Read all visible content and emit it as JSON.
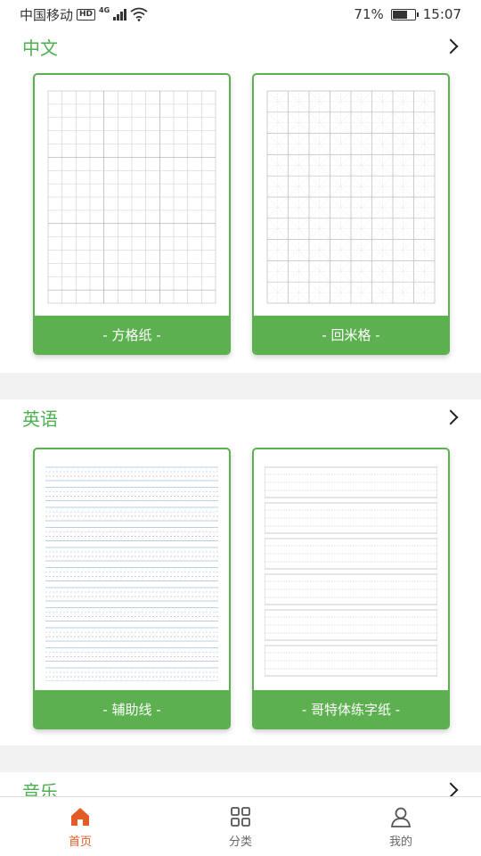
{
  "status_bar": {
    "carrier": "中国移动",
    "hd": "HD",
    "network": "4G",
    "battery_percent": "71%",
    "battery_level": 0.71,
    "time": "15:07"
  },
  "sections": [
    {
      "title": "中文",
      "cards": [
        {
          "caption": "- 方格纸 -"
        },
        {
          "caption": "- 回米格 -"
        }
      ]
    },
    {
      "title": "英语",
      "cards": [
        {
          "caption": "- 辅助线 -"
        },
        {
          "caption": "- 哥特体练字纸 -"
        }
      ]
    },
    {
      "title": "音乐"
    }
  ],
  "tabbar": {
    "tabs": [
      {
        "label": "首页",
        "icon": "home-icon",
        "active": true
      },
      {
        "label": "分类",
        "icon": "grid-icon",
        "active": false
      },
      {
        "label": "我的",
        "icon": "user-icon",
        "active": false
      }
    ],
    "accent_color": "#e45b26"
  },
  "colors": {
    "brand_green": "#5db04f",
    "title_green": "#4caf50"
  }
}
